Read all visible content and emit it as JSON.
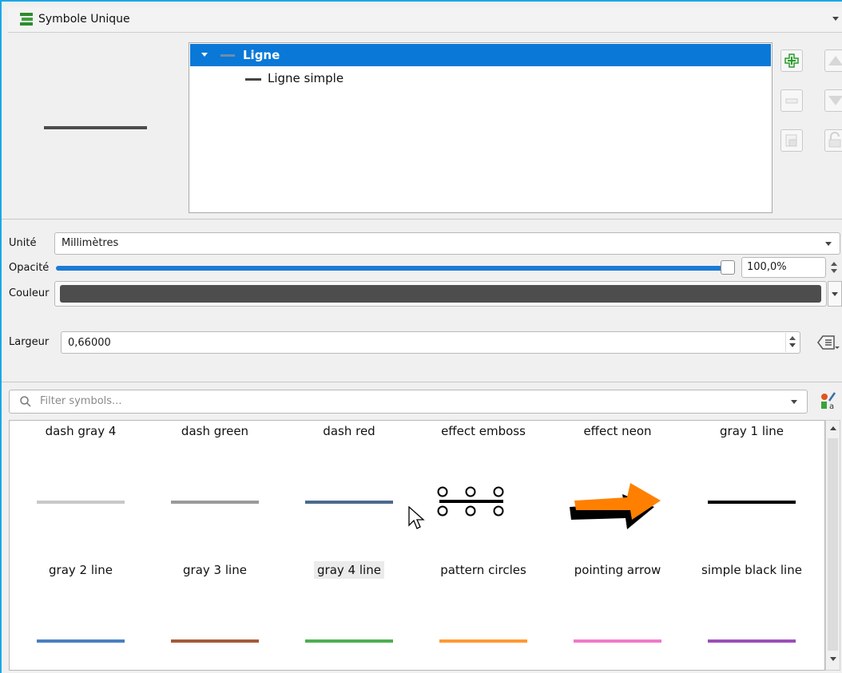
{
  "header": {
    "title": "Symbole Unique"
  },
  "layer_tree": {
    "root_label": "Ligne",
    "child_label": "Ligne simple"
  },
  "form": {
    "unit_label": "Unité",
    "unit_value": "Millimètres",
    "opacity_label": "Opacité",
    "opacity_value": "100,0%",
    "opacity_fraction": 1.0,
    "color_label": "Couleur",
    "color_value": "#4d4d4d",
    "width_label": "Largeur",
    "width_value": "0,66000"
  },
  "filter": {
    "placeholder": "Filter symbols..."
  },
  "symbols": {
    "row1": [
      "dash gray 4",
      "dash green",
      "dash red",
      "effect emboss",
      "effect neon",
      "gray 1 line"
    ],
    "row2": [
      "gray 2 line",
      "gray 3 line",
      "gray 4 line",
      "pattern circles",
      "pointing arrow",
      "simple  black line"
    ],
    "row1_colors": [
      "#c8c8c8",
      "#9a9a9a",
      "#4a6a8c",
      "#000000",
      "#ff8000",
      "#000000"
    ],
    "row3_colors": [
      "#4a7fc1",
      "#a55a3a",
      "#4caf50",
      "#ff9933",
      "#f07ac8",
      "#9b4fb8"
    ],
    "selected": "gray 4 line"
  },
  "colors": {
    "accent": "#0a78d7",
    "frame": "#1aa7e6"
  }
}
